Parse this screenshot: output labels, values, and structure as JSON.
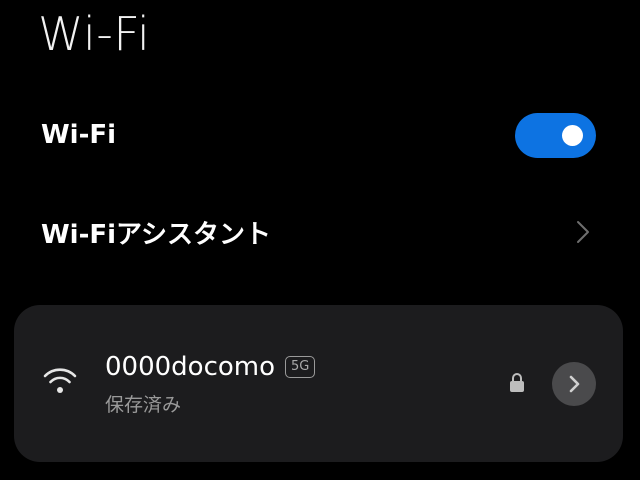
{
  "header": {
    "title": "Wi-Fi"
  },
  "settings": {
    "wifi_toggle": {
      "label": "Wi-Fi",
      "enabled": true,
      "accent_color": "#0d73e2"
    },
    "wifi_assistant": {
      "label": "Wi-Fiアシスタント",
      "icon": "chevron-right-icon"
    }
  },
  "networks": [
    {
      "ssid": "0000docomo",
      "band": "5G",
      "status": "保存済み",
      "secured": true,
      "icons": [
        "wifi-signal-icon",
        "lock-icon",
        "chevron-right-icon"
      ]
    }
  ]
}
